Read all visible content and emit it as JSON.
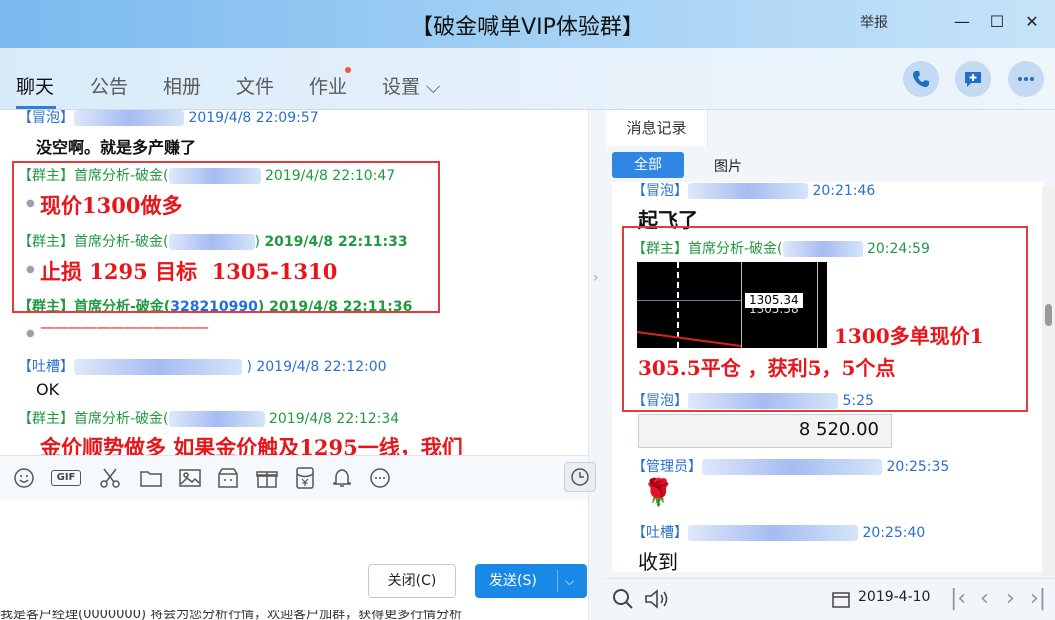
{
  "window": {
    "title": "【破金喊单VIP体验群】",
    "report_label": "举报",
    "minimize": "—",
    "maximize": "☐",
    "close": "✕"
  },
  "tabs": [
    {
      "label": "聊天"
    },
    {
      "label": "公告"
    },
    {
      "label": "相册"
    },
    {
      "label": "文件"
    },
    {
      "label": "作业"
    },
    {
      "label": "设置 ⌵"
    }
  ],
  "chat": {
    "messages": [
      {
        "role": "【冒泡】",
        "time": "2019/4/8 22:09:57",
        "text": "没空啊。就是多产赚了"
      },
      {
        "role": "【群主】",
        "name": "首席分析-破金(",
        "time": "2019/4/8 22:10:47",
        "text": "现价1300做多"
      },
      {
        "role": "【群主】",
        "name": "首席分析-破金(",
        "name_end": ")",
        "time": "2019/4/8 22:11:33",
        "text": "止损 1295 目标  1305-1310"
      },
      {
        "role": "【群主】",
        "name": "首席分析-破金(",
        "qq": "328210990",
        "name_end": ")",
        "time": "2019/4/8 22:11:36",
        "text": "————————————"
      },
      {
        "role": "【吐槽】",
        "time": ") 2019/4/8 22:12:00",
        "text": "OK"
      },
      {
        "role": "【群主】",
        "name": "首席分析-破金(",
        "time": "2019/4/8 22:12:34",
        "text": "金价顺势做多  如果金价触及1295一线，我们"
      }
    ]
  },
  "toolbar": {
    "icons": [
      "emoji-icon",
      "gif-icon",
      "scissors-icon",
      "folder-icon",
      "image-icon",
      "shop-icon",
      "gift-icon",
      "red-packet-icon",
      "bell-icon",
      "more-icon"
    ],
    "gif_label": "GIF"
  },
  "buttons": {
    "close_label": "关闭(C)",
    "send_label": "发送(S)",
    "send_dropdown": "⌵"
  },
  "bottom_clipped_text": "我是客户经理(0000000) 将会为您分析行情，欢迎客户加群，获得更多行情分析",
  "history": {
    "tab_label": "消息记录",
    "filter_all": "全部",
    "filter_images": "图片",
    "entries": [
      {
        "role": "【冒泡】",
        "time": "20:21:46",
        "text": "起飞了"
      },
      {
        "role": "【群主】",
        "name": "首席分析-破金(",
        "time": "20:24:59"
      },
      {
        "role": "【冒泡】",
        "time": "5:25"
      },
      {
        "role": "【管理员】",
        "time": "20:25:35"
      },
      {
        "role": "【吐槽】",
        "time": "20:25:40",
        "text": "收到"
      }
    ],
    "chart_price": "1305.34",
    "chart_price_shadow": "1305.58",
    "annotation_line1": "1300多单现价1",
    "annotation_line2": "305.5平仓 ，获利5，5个点",
    "quote_value": "8 520.00",
    "rose": "🌹",
    "date": "2019-4-10"
  },
  "colors": {
    "accent": "#1989e8",
    "group_owner": "#1f9a41",
    "highlight_red": "#e8161a",
    "box_red": "#e23b3b"
  }
}
